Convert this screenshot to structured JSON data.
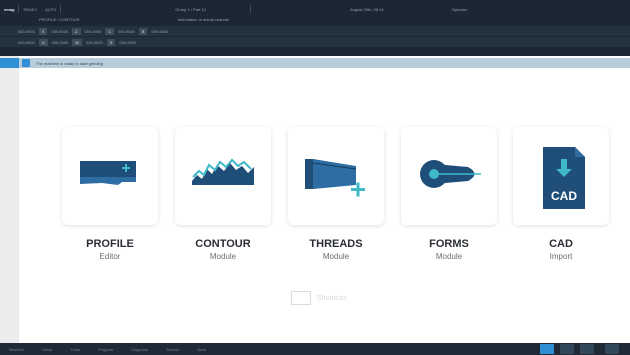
{
  "topbar": {
    "brand": "emag",
    "status1": "READY",
    "status2": "AUTO",
    "path": "Group 1 / Part 12",
    "program": "PROFILE / CONTOUR",
    "info": "Information of actual channel",
    "datetime": "August 20th, 08:14",
    "user": "Operator",
    "val1": "000.0000",
    "val2": "000.0000"
  },
  "notice": {
    "text": "The machine is ready to start grinding"
  },
  "cards": [
    {
      "title": "PROFILE",
      "subtitle": "Editor"
    },
    {
      "title": "CONTOUR",
      "subtitle": "Module"
    },
    {
      "title": "THREADS",
      "subtitle": "Module"
    },
    {
      "title": "FORMS",
      "subtitle": "Module"
    },
    {
      "title": "CAD",
      "subtitle": "Import"
    }
  ],
  "cad_icon_label": "CAD",
  "bottom_shadow_label": "Shortcuts",
  "bottombar": {
    "items": [
      "Machine",
      "Setup",
      "Tools",
      "Program",
      "Diagnose",
      "Service",
      "Data"
    ]
  },
  "colors": {
    "accent": "#2f8fd6",
    "dark": "#1c2733",
    "teal": "#3fb8c8"
  },
  "icons": [
    "profile-editor-icon",
    "contour-module-icon",
    "threads-module-icon",
    "forms-module-icon",
    "cad-import-icon"
  ]
}
